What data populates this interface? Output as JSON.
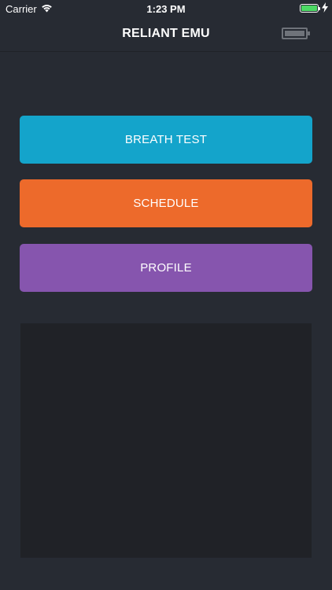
{
  "status_bar": {
    "carrier": "Carrier",
    "time": "1:23 PM",
    "icons": [
      "wifi-icon",
      "battery-icon",
      "charging-bolt-icon"
    ]
  },
  "nav": {
    "title": "RELIANT EMU",
    "device_icon": "device-battery-icon"
  },
  "menu": {
    "breath_test_label": "BREATH TEST",
    "schedule_label": "SCHEDULE",
    "profile_label": "PROFILE"
  },
  "colors": {
    "background": "#272b33",
    "breath_test": "#14a4cb",
    "schedule": "#ed6a2b",
    "profile": "#8655ae",
    "panel": "#202227",
    "battery_charge": "#4cd964"
  }
}
